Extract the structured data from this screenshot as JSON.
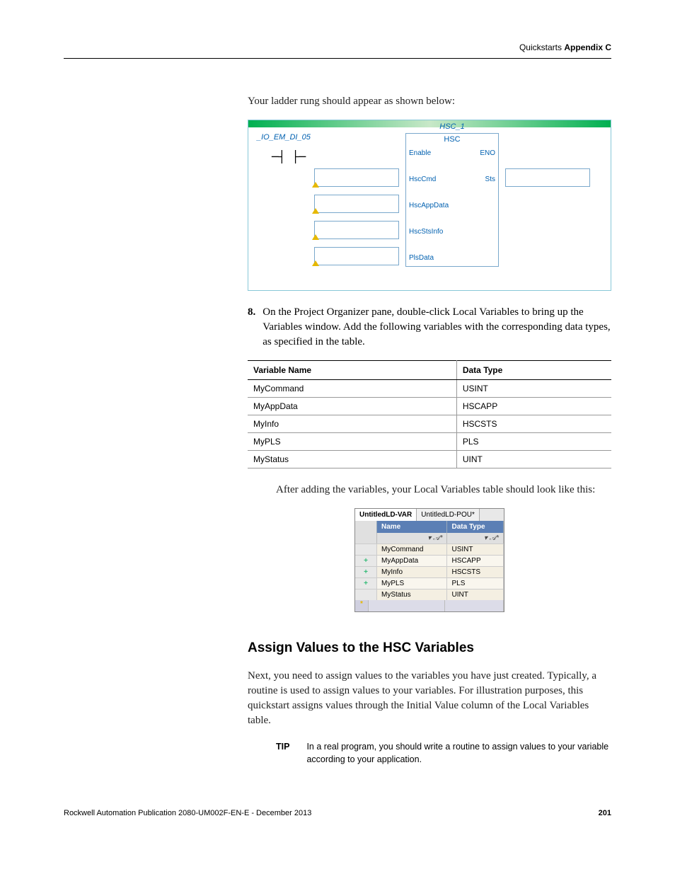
{
  "header": {
    "left": "Quickstarts",
    "right": "Appendix C"
  },
  "intro_text": "Your ladder rung should appear as shown below:",
  "figure1": {
    "contact_label": "_IO_EM_DI_05",
    "fb_instance": "HSC_1",
    "fb_type": "HSC",
    "pins_left": [
      "Enable",
      "HscCmd",
      "HscAppData",
      "HscStsInfo",
      "PlsData"
    ],
    "pins_right": [
      "ENO",
      "Sts"
    ]
  },
  "step8": {
    "num": "8.",
    "text": "On the Project Organizer pane, double-click Local Variables to bring up the Variables window. Add the following variables with the corresponding data types, as specified in the table."
  },
  "vars_table": {
    "headers": [
      "Variable Name",
      "Data Type"
    ],
    "rows": [
      [
        "MyCommand",
        "USINT"
      ],
      [
        "MyAppData",
        "HSCAPP"
      ],
      [
        "MyInfo",
        "HSCSTS"
      ],
      [
        "MyPLS",
        "PLS"
      ],
      [
        "MyStatus",
        "UINT"
      ]
    ]
  },
  "after_text": "After adding the variables, your Local Variables table should look like this:",
  "lv_fig": {
    "tabs": [
      "UntitledLD-VAR",
      "UntitledLD-POU*"
    ],
    "headers": [
      "Name",
      "Data Type"
    ],
    "rows": [
      {
        "icon": "",
        "name": "MyCommand",
        "dt": "USINT"
      },
      {
        "icon": "+",
        "name": "MyAppData",
        "dt": "HSCAPP"
      },
      {
        "icon": "+",
        "name": "MyInfo",
        "dt": "HSCSTS"
      },
      {
        "icon": "+",
        "name": "MyPLS",
        "dt": "PLS"
      },
      {
        "icon": "",
        "name": "MyStatus",
        "dt": "UINT"
      }
    ]
  },
  "section_heading": "Assign Values to the HSC Variables",
  "section_body": "Next, you need to assign values to the variables you have just created. Typically, a routine is used to assign values to your variables. For illustration purposes, this quickstart assigns values through the Initial Value column of the Local Variables table.",
  "tip": {
    "label": "TIP",
    "text": "In a real program, you should write a routine to assign values to your variable according to your application."
  },
  "footer": {
    "pub": "Rockwell Automation Publication 2080-UM002F-EN-E - December 2013",
    "page": "201"
  }
}
